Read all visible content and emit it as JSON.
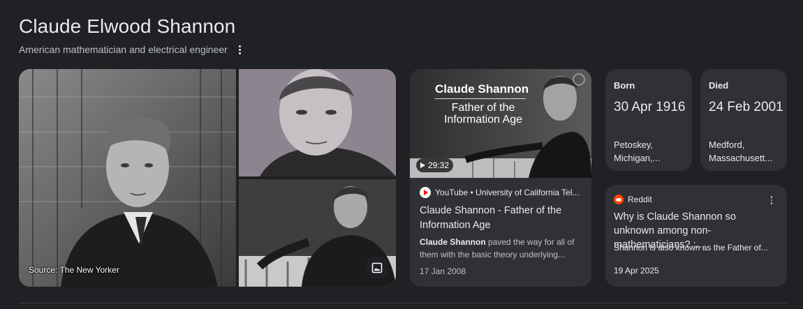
{
  "header": {
    "title": "Claude Elwood Shannon",
    "subtitle": "American mathematician and electrical engineer"
  },
  "gallery": {
    "caption": "Source: The New Yorker",
    "image_button_icon": "image-icon"
  },
  "video": {
    "thumb_title_line1": "Claude Shannon",
    "thumb_title_line2": "Father of the Information Age",
    "duration": "29:32",
    "source": "YouTube • University of California Tel...",
    "title": "Claude Shannon - Father of the Information Age",
    "snippet_bold": "Claude Shannon",
    "snippet_rest": " paved the way for all of them with the basic theory underlying...",
    "date": "17 Jan 2008"
  },
  "born": {
    "label": "Born",
    "date": "30 Apr 1916",
    "place_line1": "Petoskey,",
    "place_line2": "Michigan,..."
  },
  "died": {
    "label": "Died",
    "date": "24 Feb 2001",
    "place_line1": "Medford,",
    "place_line2": "Massachusett..."
  },
  "reddit": {
    "source": "Reddit",
    "title": "Why is Claude Shannon so unknown among non-mathematicians? :...",
    "snippet": "Shannon is also known as the Father of...",
    "date": "19 Apr 2025"
  },
  "colors": {
    "background": "#202124",
    "card": "#303134",
    "text": "#e8eaed",
    "muted": "#bdc1c6",
    "youtube_red": "#ff0000",
    "reddit_orange": "#ff4500"
  }
}
